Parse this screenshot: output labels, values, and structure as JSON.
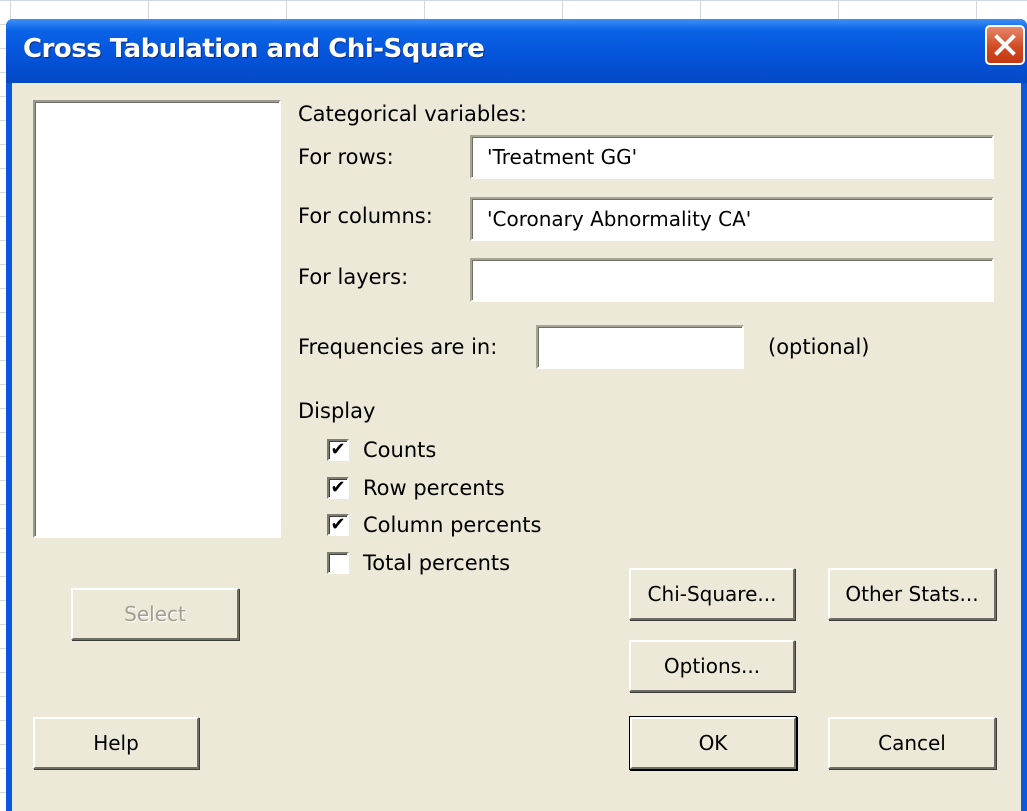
{
  "dialog": {
    "title": "Cross Tabulation and Chi-Square",
    "close_icon": "close-icon"
  },
  "variables": {
    "section_label": "Categorical variables:",
    "rows_label": "For rows:",
    "rows_value": "'Treatment GG'",
    "columns_label": "For columns:",
    "columns_value": "'Coronary Abnormality CA'",
    "layers_label": "For layers:",
    "layers_value": ""
  },
  "frequencies": {
    "label": "Frequencies are in:",
    "value": "",
    "hint": "(optional)"
  },
  "display": {
    "label": "Display",
    "options": [
      {
        "label": "Counts",
        "checked": true
      },
      {
        "label": "Row percents",
        "checked": true
      },
      {
        "label": "Column percents",
        "checked": true
      },
      {
        "label": "Total percents",
        "checked": false
      }
    ]
  },
  "buttons": {
    "select": "Select",
    "chi_square": "Chi-Square...",
    "other_stats": "Other Stats...",
    "options": "Options...",
    "help": "Help",
    "ok": "OK",
    "cancel": "Cancel"
  },
  "colors": {
    "titlebar": "#0453d9",
    "dialog_bg": "#ece9d8",
    "close": "#d34a22"
  }
}
